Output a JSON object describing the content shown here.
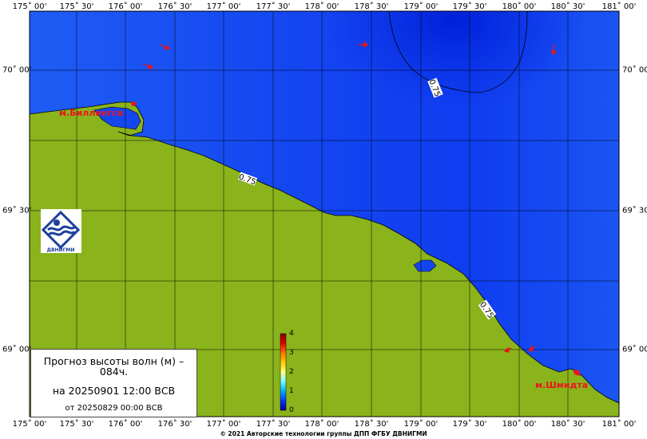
{
  "lon_labels": [
    "175˚ 00'",
    "175˚ 30'",
    "176˚ 00'",
    "176˚ 30'",
    "177˚ 00'",
    "177˚ 30'",
    "178˚ 00'",
    "178˚ 30'",
    "179˚ 00'",
    "179˚ 30'",
    "180˚ 00'",
    "180˚ 30'",
    "181˚ 00'"
  ],
  "lat_labels": [
    "70˚ 00'",
    "69˚ 30'",
    "69˚ 00'"
  ],
  "places": {
    "killen": "м.Биллингса",
    "schmidt": "м.Шмидта"
  },
  "contours": [
    "0.75",
    "0.75",
    "0.75"
  ],
  "legend": {
    "title": "Прогноз высоты волн (м) – 084ч.",
    "valid": "на 20250901 12:00 ВСВ",
    "issued": "от 20250829 00:00 ВСВ"
  },
  "scale": {
    "ticks": [
      "4",
      "3",
      "2",
      "1",
      "0"
    ]
  },
  "logo": {
    "text": "ДВНИГМИ"
  },
  "copyright": "© 2021 Авторские технологии группы ДПП ФГБУ ДВНИГМИ",
  "colors": {
    "sea": "#0f3df0",
    "sea_deep": "#0a2be0",
    "land": "#8ab31c",
    "arrow": "#e8161b"
  }
}
